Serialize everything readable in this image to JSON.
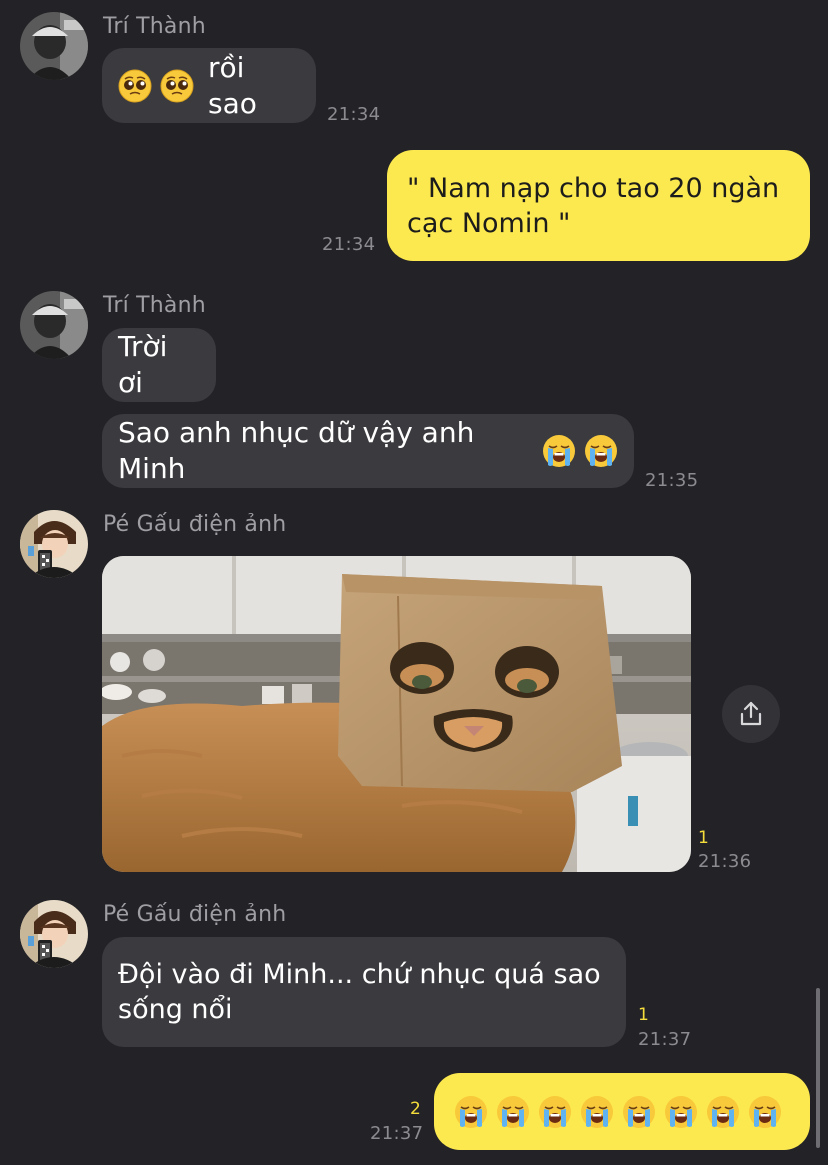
{
  "colors": {
    "background": "#232327",
    "incoming_bubble": "#3a3a3f",
    "outgoing_bubble": "#fce94f",
    "unread": "#f5de3b",
    "time": "#8b8b90"
  },
  "messages": [
    {
      "id": "m1",
      "direction": "incoming",
      "sender": "Trí Thành",
      "text": "rồi sao",
      "emoji_before": [
        "pleading-face-emoji",
        "pleading-face-emoji"
      ],
      "time": "21:34"
    },
    {
      "id": "m2",
      "direction": "outgoing",
      "text": "\" Nam nạp cho tao 20 ngàn cạc Nomin \"",
      "time": "21:34"
    },
    {
      "id": "m3",
      "direction": "incoming",
      "sender": "Trí Thành",
      "text": "Trời ơi"
    },
    {
      "id": "m4",
      "direction": "incoming",
      "text": "Sao anh nhục dữ vậy anh Minh",
      "emoji_after": [
        "loudly-crying-face-emoji",
        "loudly-crying-face-emoji"
      ],
      "time": "21:35"
    },
    {
      "id": "m5",
      "direction": "incoming",
      "sender": "Pé Gấu điện ảnh",
      "type": "image",
      "image_description_icon": "cat-in-paper-bag-photo",
      "unread": "1",
      "time": "21:36"
    },
    {
      "id": "m6",
      "direction": "incoming",
      "sender": "Pé Gấu điện ảnh",
      "text": "Đội vào đi Minh... chứ nhục quá sao sống nổi",
      "unread": "1",
      "time": "21:37"
    },
    {
      "id": "m7",
      "direction": "outgoing",
      "emoji_only": [
        "loudly-crying-face-emoji",
        "loudly-crying-face-emoji",
        "loudly-crying-face-emoji",
        "loudly-crying-face-emoji",
        "loudly-crying-face-emoji",
        "loudly-crying-face-emoji",
        "loudly-crying-face-emoji",
        "loudly-crying-face-emoji"
      ],
      "unread": "2",
      "time": "21:37"
    }
  ],
  "labels": {
    "m1_sender": "Trí Thành",
    "m1_text": "rồi sao",
    "m1_time": "21:34",
    "m2_text": "\" Nam nạp cho tao 20 ngàn\ncạc Nomin \"",
    "m2_time": "21:34",
    "m3_sender": "Trí Thành",
    "m3_text": "Trời ơi",
    "m4_text": "Sao anh nhục dữ vậy anh Minh",
    "m4_time": "21:35",
    "m5_sender": "Pé Gấu điện ảnh",
    "m5_unread": "1",
    "m5_time": "21:36",
    "m6_sender": "Pé Gấu điện ảnh",
    "m6_text": "Đội vào đi Minh... chứ nhục quá sao\nsống nổi",
    "m6_unread": "1",
    "m6_time": "21:37",
    "m7_unread": "2",
    "m7_time": "21:37"
  },
  "icons": {
    "share": "share-icon",
    "avatar_1": "avatar-tri-thanh",
    "avatar_2": "avatar-pe-gau"
  }
}
